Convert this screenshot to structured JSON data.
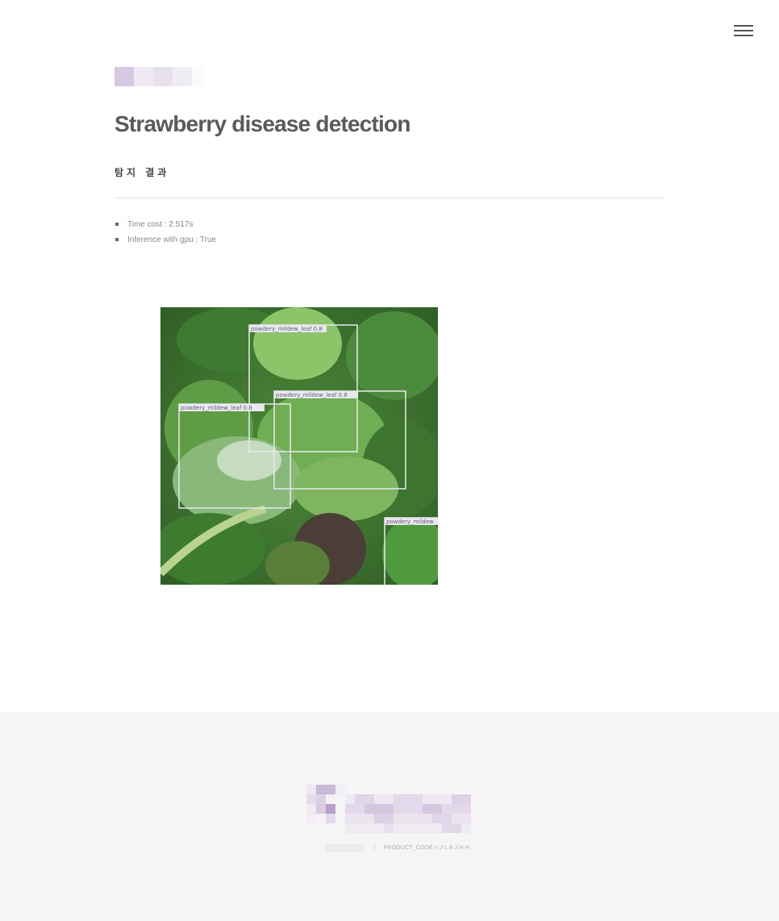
{
  "header": {
    "menu_icon": "hamburger-menu-icon",
    "logo_icon": "pixelated-logo"
  },
  "page": {
    "title": "Strawberry disease detection",
    "section_title": "탐지 결과"
  },
  "results": {
    "items": [
      {
        "label": "Time cost : 2.517s"
      },
      {
        "label": "Inference with gpu : True"
      }
    ],
    "detections": [
      {
        "label": "powdery_mildew_leaf 0.8"
      },
      {
        "label": "powdery_mildew_leaf 0.8"
      },
      {
        "label": "powdery_mildew_leaf 0.8"
      },
      {
        "label": "powdery_mildew"
      }
    ]
  },
  "footer": {
    "logo_icon": "pixelated-logo",
    "product_code": "PRODUCT_CODE = J L A J H H"
  },
  "colors": {
    "background": "#ffffff",
    "title": "#5a5a5a",
    "footer_background": "#f5f5f5",
    "logo_tint": "#c9b8d6"
  }
}
